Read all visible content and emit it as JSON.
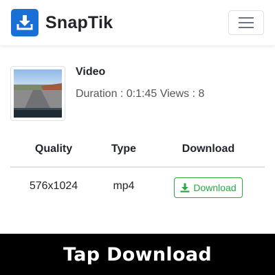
{
  "navbar": {
    "brand": "SnapTik",
    "logo_icon": "download-tray-icon",
    "menu_icon": "hamburger-menu-icon"
  },
  "video": {
    "title": "Video",
    "meta": "Duration : 0:1:45 Views : 8"
  },
  "table": {
    "headers": [
      "Quality",
      "Type",
      "Download"
    ],
    "rows": [
      {
        "quality": "576x1024",
        "type": "mp4",
        "download_label": "Download",
        "download_icon": "download-arrow-icon"
      }
    ]
  },
  "banner": {
    "text": "Tap Download"
  },
  "colors": {
    "brand_blue": "#1a6fd6",
    "success_green": "#28a745",
    "banner_bg": "#000000"
  }
}
